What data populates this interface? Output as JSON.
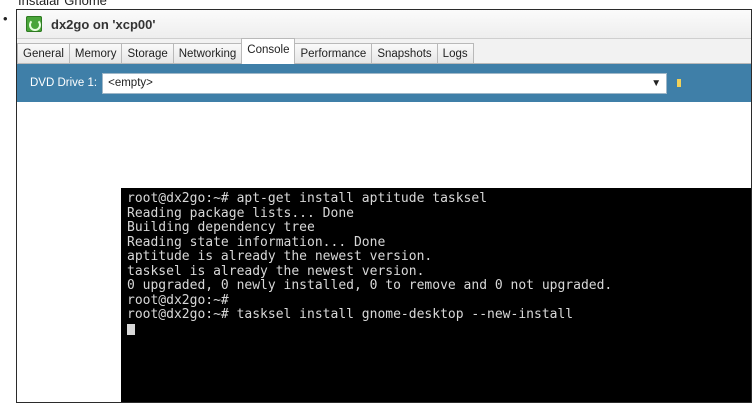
{
  "caption": "Instalar Gnome",
  "bullet": "•",
  "window": {
    "title": "dx2go on 'xcp00'"
  },
  "tabs": [
    {
      "label": "General"
    },
    {
      "label": "Memory"
    },
    {
      "label": "Storage"
    },
    {
      "label": "Networking"
    },
    {
      "label": "Console",
      "active": true
    },
    {
      "label": "Performance"
    },
    {
      "label": "Snapshots"
    },
    {
      "label": "Logs"
    }
  ],
  "dvd": {
    "label": "DVD Drive 1:",
    "value": "<empty>"
  },
  "terminal": {
    "lines": [
      "root@dx2go:~# apt-get install aptitude tasksel",
      "Reading package lists... Done",
      "Building dependency tree",
      "Reading state information... Done",
      "aptitude is already the newest version.",
      "tasksel is already the newest version.",
      "0 upgraded, 0 newly installed, 0 to remove and 0 not upgraded.",
      "root@dx2go:~#",
      "root@dx2go:~# tasksel install gnome-desktop --new-install"
    ]
  },
  "colors": {
    "toolbar_blue": "#3f7fa8",
    "terminal_bg": "#000000"
  }
}
